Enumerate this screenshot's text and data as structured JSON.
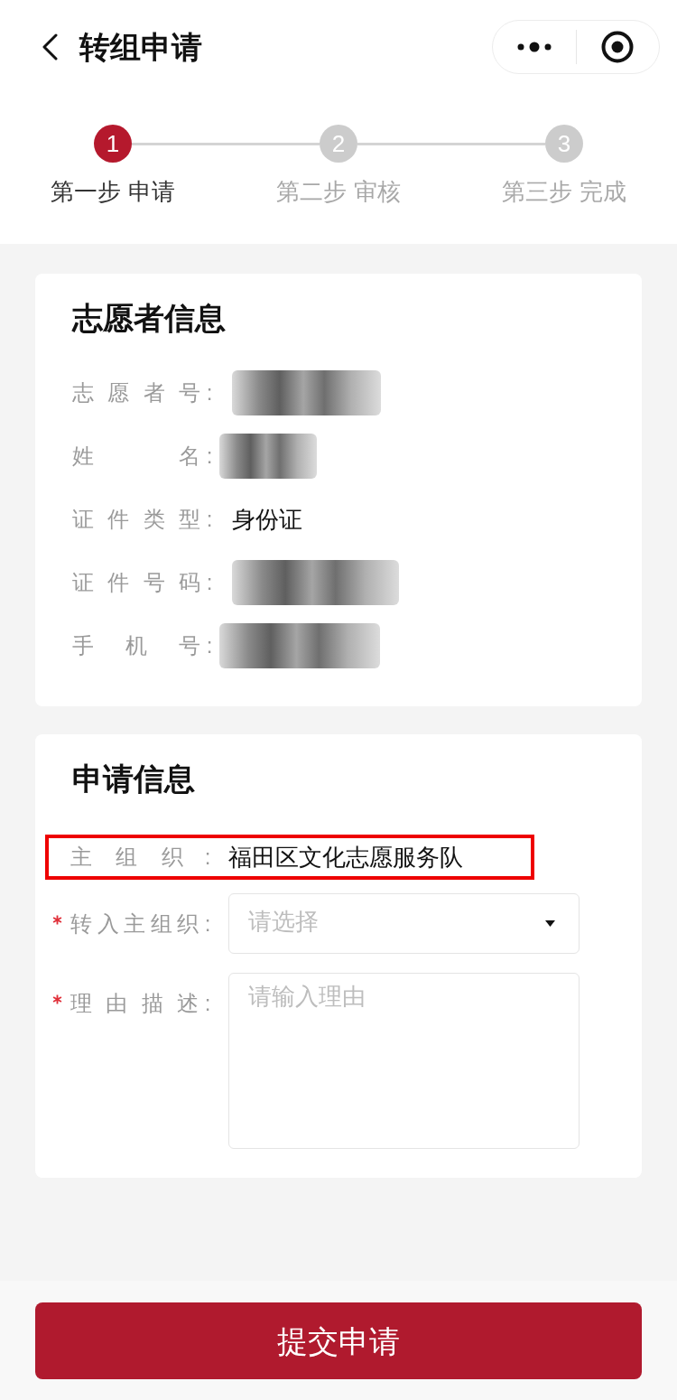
{
  "header": {
    "title": "转组申请"
  },
  "steps": [
    {
      "number": "1",
      "label": "第一步 申请",
      "active": true
    },
    {
      "number": "2",
      "label": "第二步 审核",
      "active": false
    },
    {
      "number": "3",
      "label": "第三步 完成",
      "active": false
    }
  ],
  "volunteer_info": {
    "title": "志愿者信息",
    "rows": [
      {
        "label": "志 愿 者 号",
        "colon": ":",
        "kind": "redacted"
      },
      {
        "label": "姓 名",
        "colon": ":",
        "kind": "redacted"
      },
      {
        "label": "证 件 类 型",
        "colon": ":",
        "kind": "text",
        "value": "身份证"
      },
      {
        "label": "证 件 号 码",
        "colon": ":",
        "kind": "redacted"
      },
      {
        "label": "手 机 号",
        "colon": ":",
        "kind": "redacted"
      }
    ]
  },
  "application_info": {
    "title": "申请信息",
    "rows": [
      {
        "kind": "text",
        "label": "主 组 织",
        "colon": ":",
        "value": "福田区文化志愿服务队",
        "required": false,
        "highlighted": true
      },
      {
        "kind": "select",
        "label": "转入主组织",
        "colon": ":",
        "placeholder": "请选择",
        "required": true,
        "highlighted": false
      },
      {
        "kind": "textarea",
        "label": "理 由 描 述",
        "colon": ":",
        "placeholder": "请输入理由",
        "required": true,
        "highlighted": false
      }
    ]
  },
  "submit_button": {
    "label": "提交申请"
  }
}
